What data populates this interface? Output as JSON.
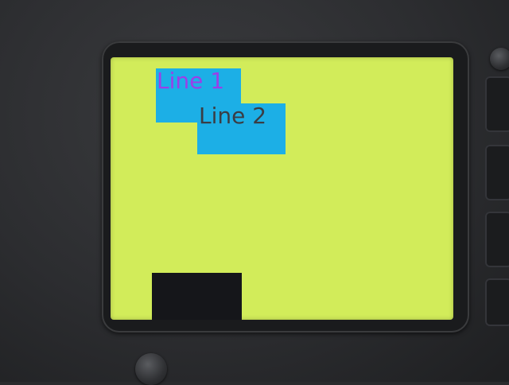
{
  "screen": {
    "background_color": "#d2ec5a",
    "lines": [
      {
        "text": "Line 1",
        "text_color": "#9b3fe8",
        "box_color": "#1cafe6"
      },
      {
        "text": "Line 2",
        "text_color": "#3a3d44",
        "box_color": "#1cafe6"
      }
    ],
    "filled_rect_color": "#15161a"
  },
  "device": {
    "controls": [
      "knob-icon",
      "side-button",
      "side-button",
      "side-button",
      "side-button",
      "screw-icon"
    ]
  }
}
